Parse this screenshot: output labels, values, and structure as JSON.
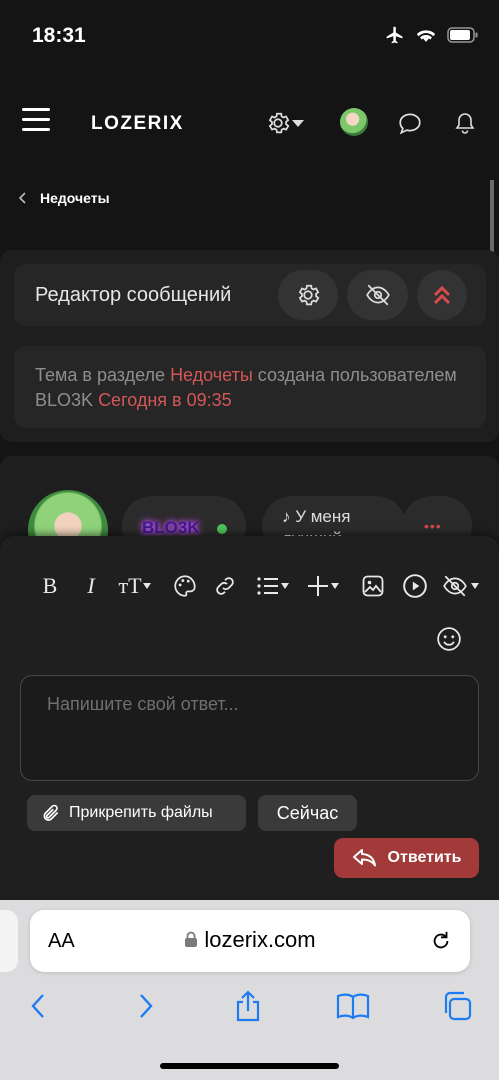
{
  "status_bar": {
    "time": "18:31"
  },
  "header": {
    "logo": "LOZERIX"
  },
  "breadcrumb": {
    "label": "Недочеты"
  },
  "editor": {
    "title": "Редактор сообщений"
  },
  "thread_info": {
    "prefix": "Тема в разделе ",
    "section": "Недочеты",
    "middle": " создана пользователем ",
    "author": "BLO3K",
    "space": " ",
    "time": "Сегодня в 09:35"
  },
  "post": {
    "username": "BLO3K",
    "status_line1": "♪ У меня",
    "status_line2": "лучший",
    "more": "•••"
  },
  "composer": {
    "placeholder": "Напишите свой ответ...",
    "toolbar": {
      "bold": "B",
      "italic": "I",
      "text_size": "тT"
    },
    "attach_label": "Прикрепить файлы",
    "now_label": "Сейчас",
    "reply_label": "Ответить"
  },
  "browser": {
    "text_size": "AA",
    "url": "lozerix.com"
  },
  "colors": {
    "accent": "#d25757",
    "reply_button": "#a33a3a",
    "online": "#4cc35a"
  }
}
